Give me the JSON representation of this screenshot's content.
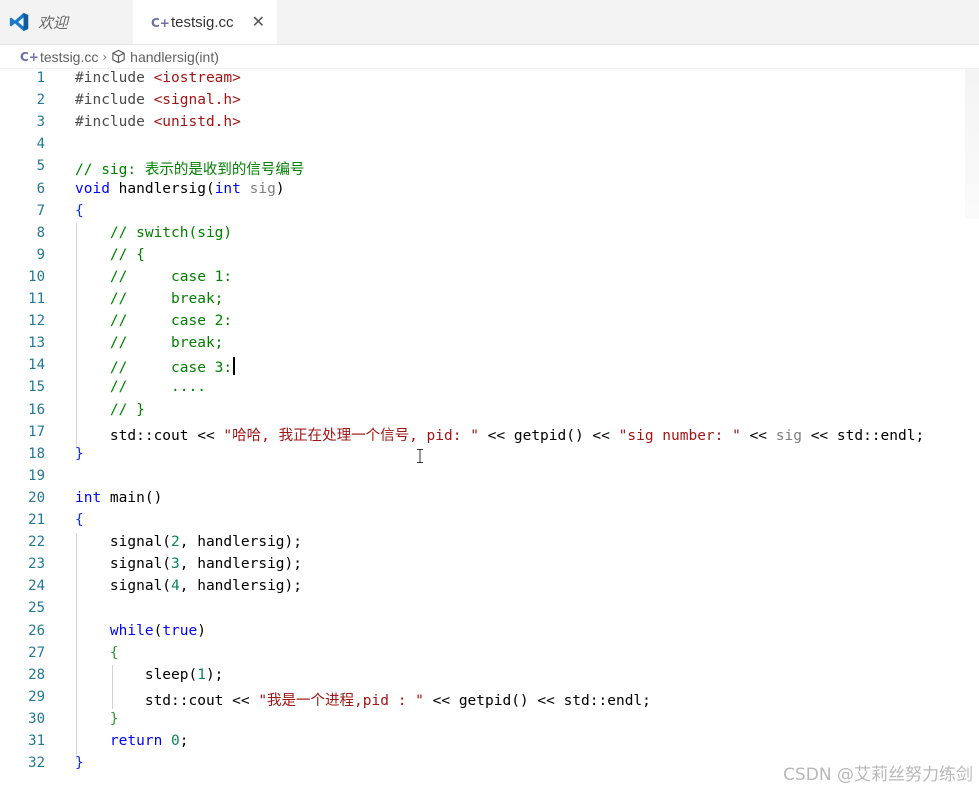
{
  "tabs": [
    {
      "label": "欢迎",
      "icon": "vscode-logo-icon"
    },
    {
      "label": "testsig.cc",
      "icon": "cpp-file-icon",
      "active": true
    }
  ],
  "breadcrumb": {
    "file": "testsig.cc",
    "symbol": "handlersig(int)"
  },
  "watermark": "CSDN @艾莉丝努力练剑",
  "colors": {
    "comment": "#008000",
    "keyword": "#0000ff",
    "string": "#a31515",
    "number": "#098658",
    "line_number": "#237893",
    "brace": "#0431fa"
  },
  "code_lines": [
    {
      "n": "1",
      "t": [
        [
          "pre",
          "#include "
        ],
        [
          "include",
          "<iostream>"
        ]
      ]
    },
    {
      "n": "2",
      "t": [
        [
          "pre",
          "#include "
        ],
        [
          "include",
          "<signal.h>"
        ]
      ]
    },
    {
      "n": "3",
      "t": [
        [
          "pre",
          "#include "
        ],
        [
          "include",
          "<unistd.h>"
        ]
      ]
    },
    {
      "n": "4",
      "t": []
    },
    {
      "n": "5",
      "t": [
        [
          "comment",
          "// sig: 表示的是收到的信号编号"
        ]
      ]
    },
    {
      "n": "6",
      "t": [
        [
          "keyword",
          "void"
        ],
        [
          "default",
          " handlersig("
        ],
        [
          "keyword",
          "int"
        ],
        [
          "default",
          " "
        ],
        [
          "param",
          "sig"
        ],
        [
          "default",
          ")"
        ]
      ]
    },
    {
      "n": "7",
      "t": [
        [
          "brace",
          "{"
        ]
      ]
    },
    {
      "n": "8",
      "t": [
        [
          "default",
          "    "
        ],
        [
          "comment",
          "// switch(sig)"
        ]
      ]
    },
    {
      "n": "9",
      "t": [
        [
          "default",
          "    "
        ],
        [
          "comment",
          "// {"
        ]
      ]
    },
    {
      "n": "10",
      "t": [
        [
          "default",
          "    "
        ],
        [
          "comment",
          "//     case 1:"
        ]
      ]
    },
    {
      "n": "11",
      "t": [
        [
          "default",
          "    "
        ],
        [
          "comment",
          "//     break;"
        ]
      ]
    },
    {
      "n": "12",
      "t": [
        [
          "default",
          "    "
        ],
        [
          "comment",
          "//     case 2:"
        ]
      ]
    },
    {
      "n": "13",
      "t": [
        [
          "default",
          "    "
        ],
        [
          "comment",
          "//     break;"
        ]
      ]
    },
    {
      "n": "14",
      "t": [
        [
          "default",
          "    "
        ],
        [
          "comment",
          "//     case 3:"
        ]
      ],
      "cursor": true
    },
    {
      "n": "15",
      "t": [
        [
          "default",
          "    "
        ],
        [
          "comment",
          "//     ...."
        ]
      ]
    },
    {
      "n": "16",
      "t": [
        [
          "default",
          "    "
        ],
        [
          "comment",
          "// }"
        ]
      ]
    },
    {
      "n": "17",
      "t": [
        [
          "default",
          "    std::cout << "
        ],
        [
          "string",
          "\"哈哈, 我正在处理一个信号, pid: \""
        ],
        [
          "default",
          " << getpid() << "
        ],
        [
          "string",
          "\"sig number: \""
        ],
        [
          "default",
          " << "
        ],
        [
          "param",
          "sig"
        ],
        [
          "default",
          " << std::endl;"
        ]
      ]
    },
    {
      "n": "18",
      "t": [
        [
          "brace",
          "}"
        ]
      ]
    },
    {
      "n": "19",
      "t": []
    },
    {
      "n": "20",
      "t": [
        [
          "keyword",
          "int"
        ],
        [
          "default",
          " main()"
        ]
      ]
    },
    {
      "n": "21",
      "t": [
        [
          "brace",
          "{"
        ]
      ]
    },
    {
      "n": "22",
      "t": [
        [
          "default",
          "    signal("
        ],
        [
          "number",
          "2"
        ],
        [
          "default",
          ", handlersig);"
        ]
      ]
    },
    {
      "n": "23",
      "t": [
        [
          "default",
          "    signal("
        ],
        [
          "number",
          "3"
        ],
        [
          "default",
          ", handlersig);"
        ]
      ]
    },
    {
      "n": "24",
      "t": [
        [
          "default",
          "    signal("
        ],
        [
          "number",
          "4"
        ],
        [
          "default",
          ", handlersig);"
        ]
      ]
    },
    {
      "n": "25",
      "t": []
    },
    {
      "n": "26",
      "t": [
        [
          "default",
          "    "
        ],
        [
          "keyword",
          "while"
        ],
        [
          "default",
          "("
        ],
        [
          "keyword",
          "true"
        ],
        [
          "default",
          ")"
        ]
      ]
    },
    {
      "n": "27",
      "t": [
        [
          "default",
          "    "
        ],
        [
          "brace2",
          "{"
        ]
      ]
    },
    {
      "n": "28",
      "t": [
        [
          "default",
          "        sleep("
        ],
        [
          "number",
          "1"
        ],
        [
          "default",
          ");"
        ]
      ]
    },
    {
      "n": "29",
      "t": [
        [
          "default",
          "        std::cout << "
        ],
        [
          "string",
          "\"我是一个进程,pid : \""
        ],
        [
          "default",
          " << getpid() << std::endl;"
        ]
      ]
    },
    {
      "n": "30",
      "t": [
        [
          "default",
          "    "
        ],
        [
          "brace2",
          "}"
        ]
      ]
    },
    {
      "n": "31",
      "t": [
        [
          "default",
          "    "
        ],
        [
          "keyword",
          "return"
        ],
        [
          "default",
          " "
        ],
        [
          "number",
          "0"
        ],
        [
          "default",
          ";"
        ]
      ]
    },
    {
      "n": "32",
      "t": [
        [
          "brace",
          "}"
        ]
      ]
    }
  ]
}
